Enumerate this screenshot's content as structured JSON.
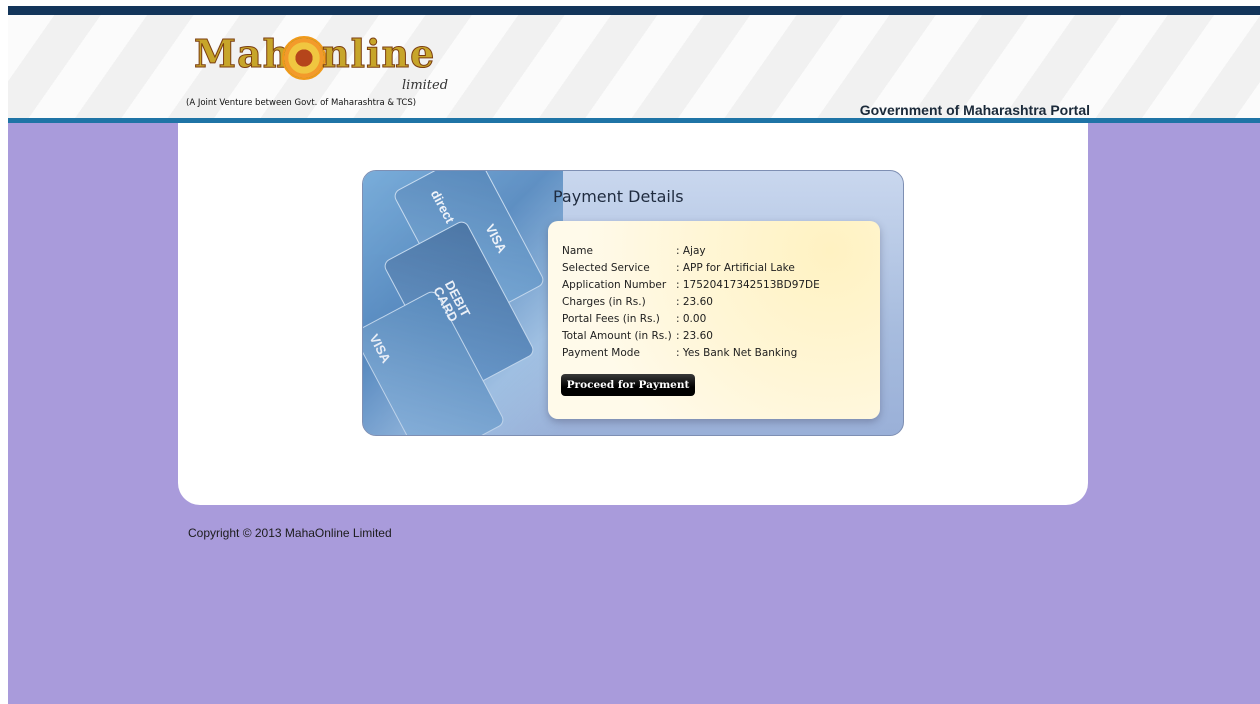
{
  "header": {
    "logo_left": "Maha",
    "logo_right": "nline",
    "logo_limited": "limited",
    "tagline": "(A Joint Venture between Govt. of Maharashtra & TCS)",
    "portal_title": "Government of Maharashtra Portal"
  },
  "payment": {
    "title": "Payment Details",
    "rows": [
      {
        "label": "Name",
        "value": ": Ajay"
      },
      {
        "label": "Selected Service",
        "value": ": APP for Artificial Lake"
      },
      {
        "label": "Application Number",
        "value": ": 17520417342513BD97DE"
      },
      {
        "label": "Charges (in Rs.)",
        "value": ": 23.60"
      },
      {
        "label": "Portal Fees (in Rs.)",
        "value": ": 0.00"
      },
      {
        "label": "Total Amount (in Rs.)",
        "value": ": 23.60"
      },
      {
        "label": "Payment Mode",
        "value": ": Yes Bank Net Banking"
      }
    ],
    "proceed_label": "Proceed for Payment",
    "card_art_labels": [
      "direct",
      "VISA",
      "DEBIT CARD",
      "VISA"
    ]
  },
  "footer": {
    "copyright": "Copyright © 2013 MahaOnline Limited"
  },
  "colors": {
    "page_background": "#a99bdb",
    "top_bar": "#13355a",
    "header_accent_line": "#1f74a6",
    "details_box": "#fff6d6",
    "button": "#000000"
  }
}
